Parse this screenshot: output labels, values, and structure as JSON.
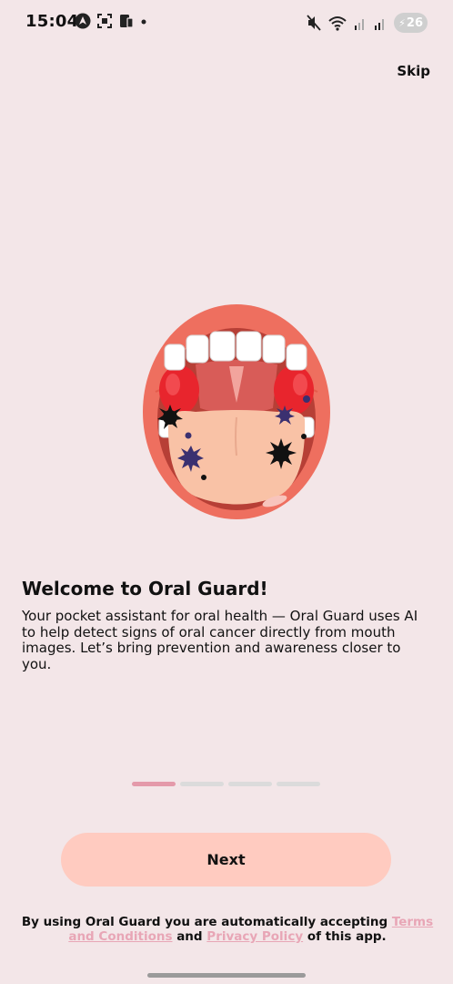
{
  "status_bar": {
    "time": "15:04",
    "battery": "26"
  },
  "header": {
    "skip_label": "Skip"
  },
  "onboarding": {
    "title": "Welcome to Oral Guard!",
    "description": "Your pocket assistant for oral health — Oral Guard uses AI to help detect signs of oral cancer directly from mouth images. Let’s bring prevention and awareness closer to you.",
    "current_page": 1,
    "total_pages": 4
  },
  "actions": {
    "next_label": "Next"
  },
  "footer": {
    "text_prefix": "By using Oral Guard you are automatically accepting ",
    "terms_label": "Terms and Conditions",
    "text_and": " and ",
    "privacy_label": "Privacy Policy",
    "text_suffix": " of this app."
  },
  "colors": {
    "background": "#F3E6E8",
    "button": "#FFCBC0",
    "link": "#E8A6B6",
    "pager_active": "#E49AAA",
    "pager_inactive": "#DBDBDB"
  },
  "icons": {
    "status_left": [
      "navigation-icon",
      "screenshot-icon",
      "phone-clipboard-icon",
      "dot-icon"
    ],
    "status_right": [
      "mute-icon",
      "wifi-icon",
      "signal-icon",
      "signal-icon",
      "battery-icon"
    ],
    "hero": "open-mouth-illustration"
  }
}
